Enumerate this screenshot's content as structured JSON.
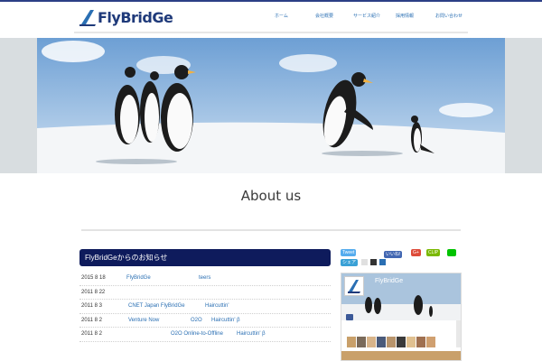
{
  "header": {
    "logo_text": "FlyBridGe",
    "nav": [
      {
        "label": "ホーム"
      },
      {
        "label": "会社概要"
      },
      {
        "label": "サービス紹介"
      },
      {
        "label": "採用情報"
      },
      {
        "label": "お問い合わせ"
      }
    ]
  },
  "main": {
    "section_title": "About us"
  },
  "news": {
    "heading": "FlyBridGeからのお知らせ",
    "items": [
      {
        "date": "2015 8 18",
        "text": "FlyBridGe",
        "text2": "teers"
      },
      {
        "date": "2011 8 22",
        "text": "",
        "text2": ""
      },
      {
        "date": "2011 8 3",
        "text": "CNET Japan FlyBridGe",
        "text2": "Haircuttin'"
      },
      {
        "date": "2011 8 2",
        "text": "Venture Now",
        "text2": "O2O",
        "text3": "Haircuttin' β"
      },
      {
        "date": "2011 8 2",
        "text": "O2O Online-to-Offline",
        "text2": "Haircuttin' β"
      }
    ]
  },
  "social": {
    "tweet": "Tweet",
    "like": "いいね!",
    "gplus": "G+",
    "clip": "CLIP",
    "share": "シェア"
  },
  "facebook": {
    "page_name": "FlyBridGe"
  },
  "colors": {
    "brand": "#1f3a7a",
    "nav_link": "#2a6fb3",
    "news_header": "#0e1b5c"
  }
}
